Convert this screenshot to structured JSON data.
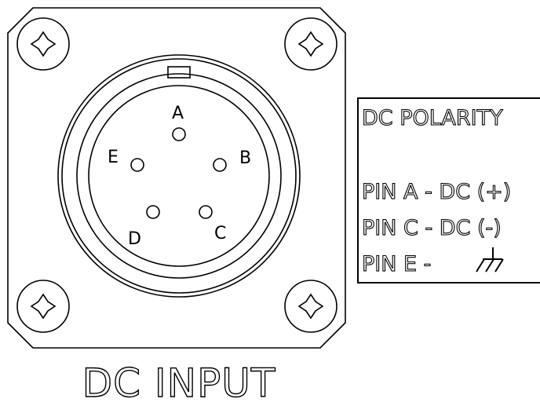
{
  "connector": {
    "pins": [
      {
        "id": "A",
        "label": "A"
      },
      {
        "id": "B",
        "label": "B"
      },
      {
        "id": "C",
        "label": "C"
      },
      {
        "id": "D",
        "label": "D"
      },
      {
        "id": "E",
        "label": "E"
      }
    ],
    "title": "DC INPUT"
  },
  "legend": {
    "heading": "DC POLARITY",
    "lines": {
      "pin_a": "PIN A - DC (+)",
      "pin_c": "PIN C - DC (-)",
      "pin_e": "PIN E -"
    },
    "ground_symbol": "chassis-ground-icon"
  },
  "colors": {
    "line": "#000000",
    "background": "#ffffff"
  }
}
